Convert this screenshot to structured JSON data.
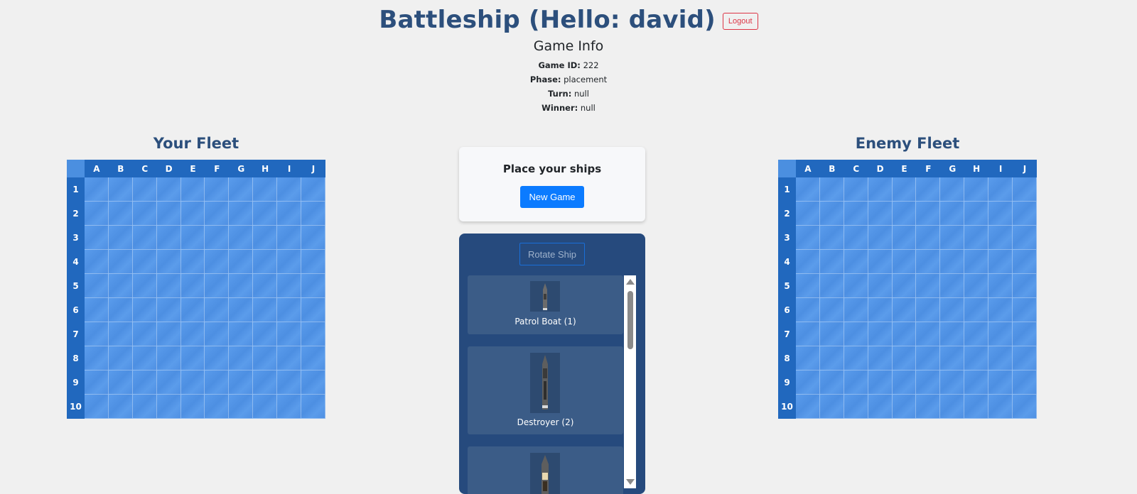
{
  "header": {
    "title": "Battleship (Hello: david)",
    "logout_label": "Logout"
  },
  "game_info": {
    "title": "Game Info",
    "game_id_label": "Game ID:",
    "game_id": "222",
    "phase_label": "Phase:",
    "phase": "placement",
    "turn_label": "Turn:",
    "turn": "null",
    "winner_label": "Winner:",
    "winner": "null"
  },
  "boards": {
    "your_fleet_title": "Your Fleet",
    "enemy_fleet_title": "Enemy Fleet",
    "columns": [
      "A",
      "B",
      "C",
      "D",
      "E",
      "F",
      "G",
      "H",
      "I",
      "J"
    ],
    "rows": [
      "1",
      "2",
      "3",
      "4",
      "5",
      "6",
      "7",
      "8",
      "9",
      "10"
    ]
  },
  "placement_panel": {
    "title": "Place your ships",
    "new_game_label": "New Game"
  },
  "ship_panel": {
    "rotate_label": "Rotate Ship",
    "ships": [
      {
        "label": "Patrol Boat (1)",
        "icon": "patrol-boat-icon"
      },
      {
        "label": "Destroyer (2)",
        "icon": "destroyer-icon"
      },
      {
        "label": "",
        "icon": "ship-icon"
      }
    ]
  },
  "colors": {
    "title": "#2c4f7c",
    "header_cells": "#2168be",
    "water": "#5a9cec",
    "primary_button": "#0b7bff",
    "logout": "#dc3545",
    "ship_panel_bg": "#264a7d"
  }
}
